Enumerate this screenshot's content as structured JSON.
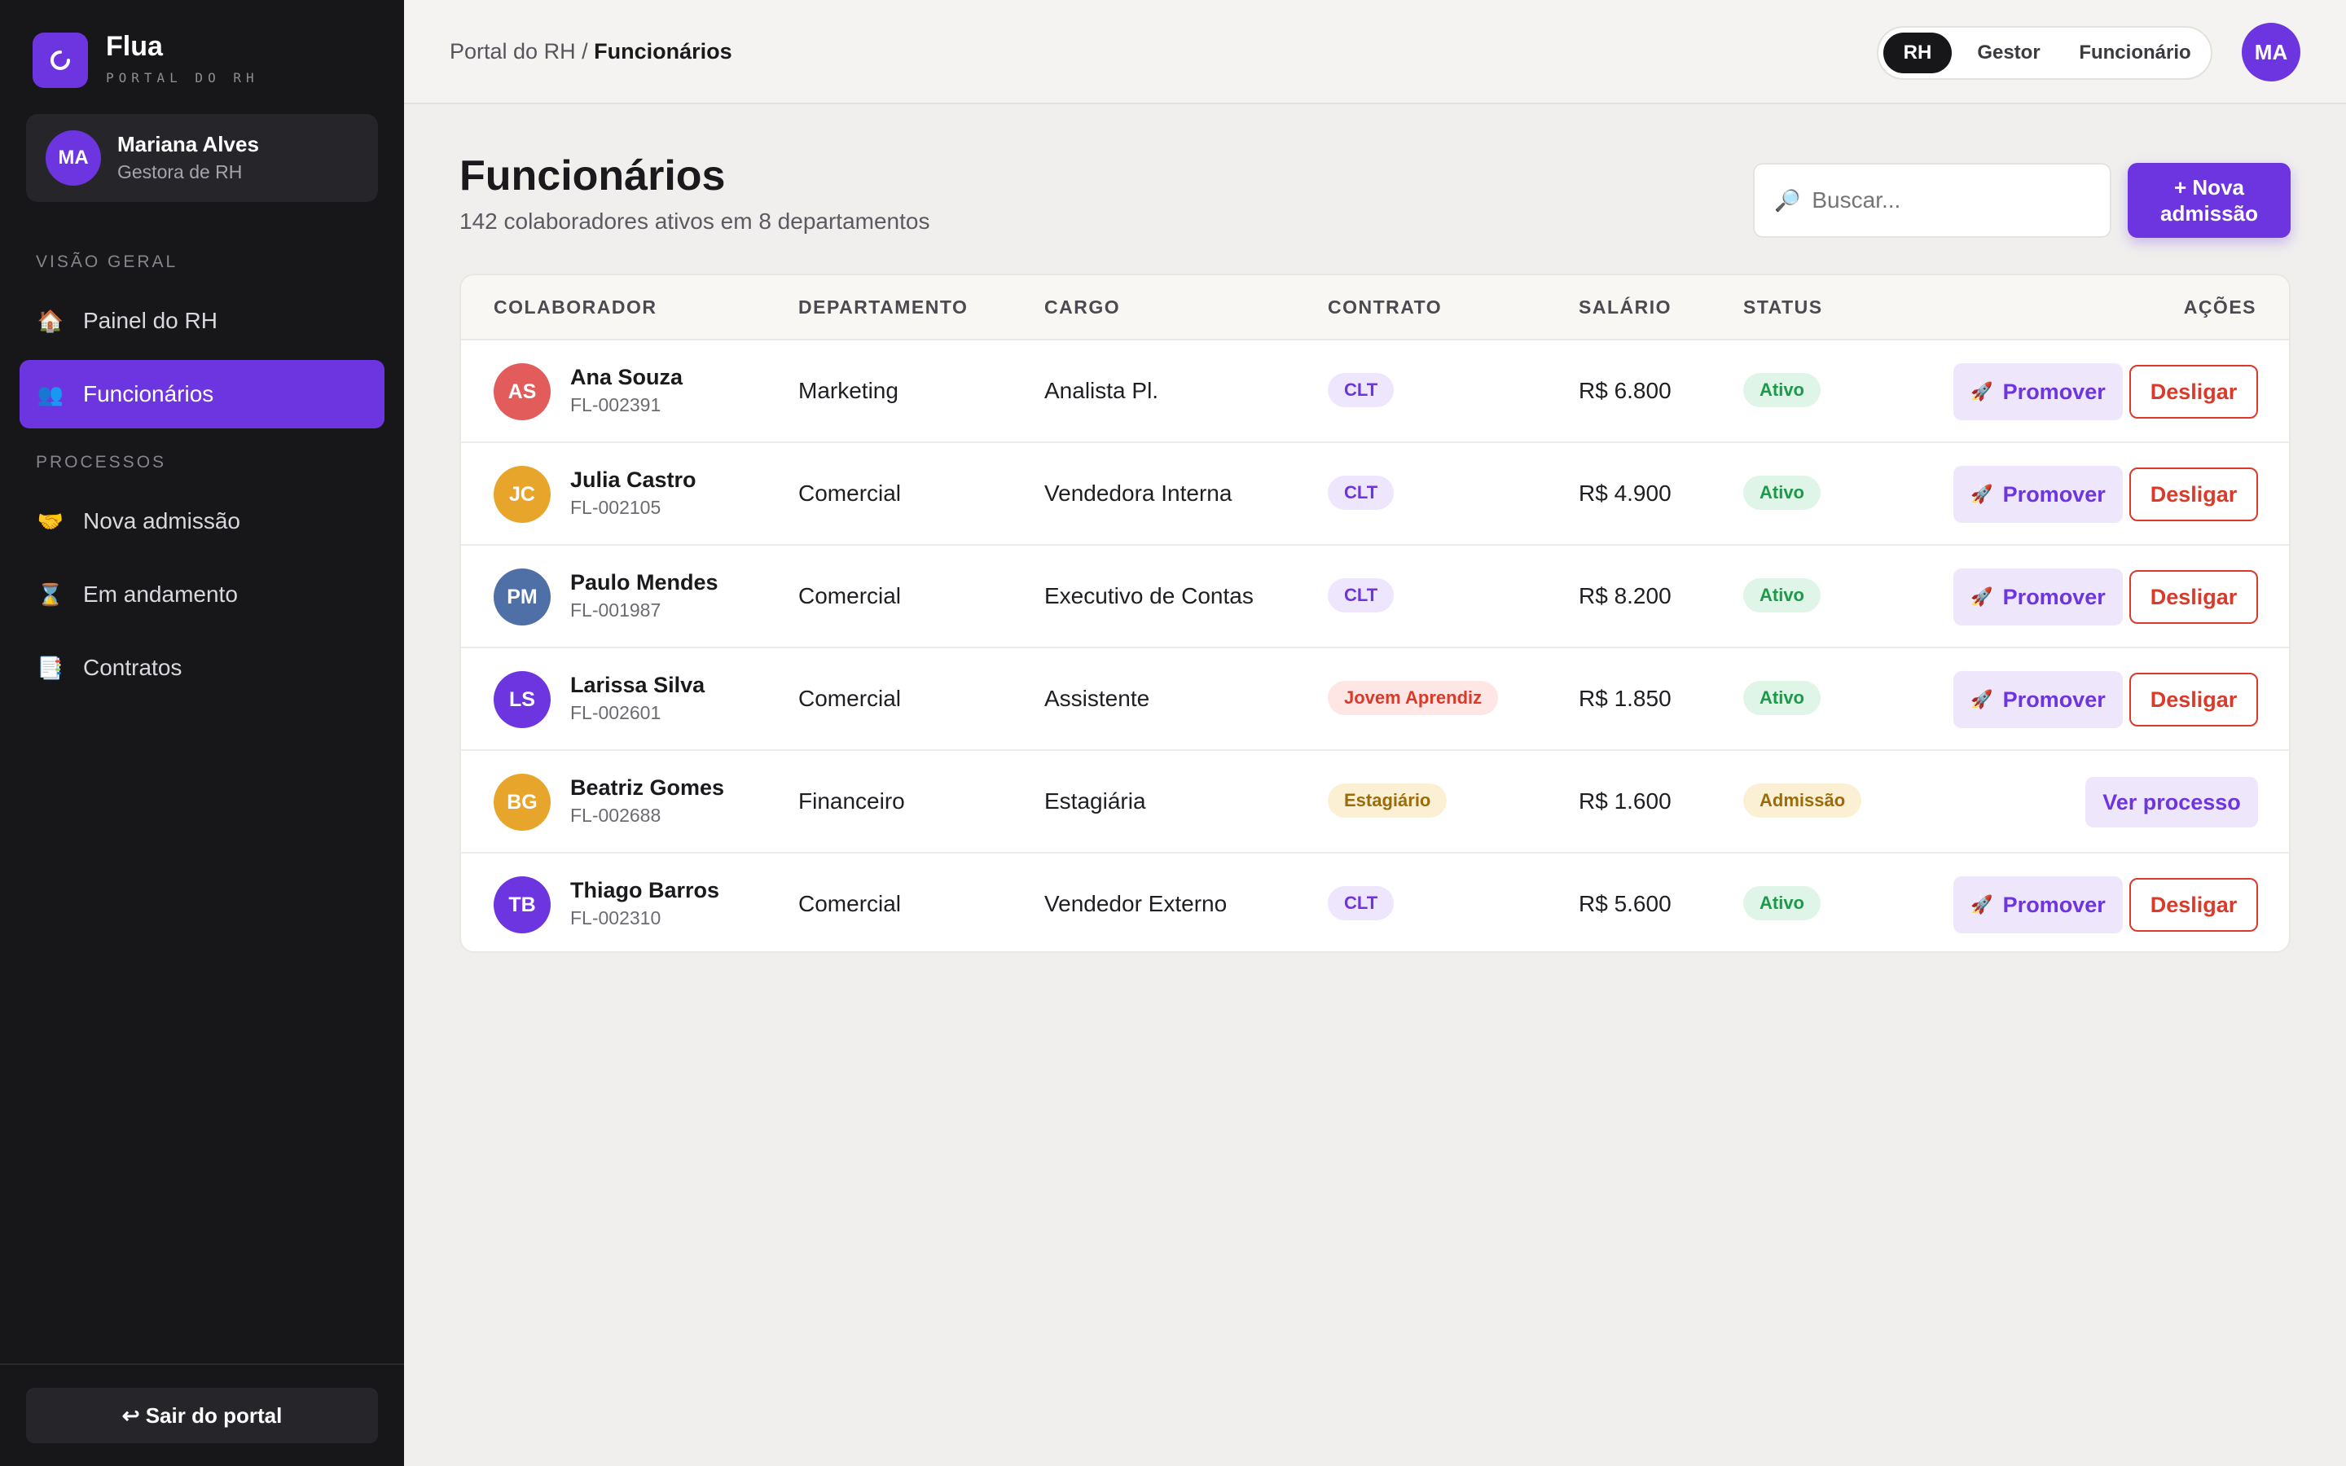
{
  "brand": {
    "name": "Flua",
    "subtitle": "PORTAL DO RH",
    "logo_icon": "refresh-icon"
  },
  "user": {
    "initials": "MA",
    "name": "Mariana Alves",
    "role": "Gestora de RH"
  },
  "sidebar": {
    "section_overview": "VISÃO GERAL",
    "section_processes": "PROCESSOS",
    "items": [
      {
        "label": "Painel do RH",
        "icon": "🏠"
      },
      {
        "label": "Funcionários",
        "icon": "👥",
        "active": true
      },
      {
        "label": "Nova admissão",
        "icon": "🤝"
      },
      {
        "label": "Em andamento",
        "icon": "⌛"
      },
      {
        "label": "Contratos",
        "icon": "📑"
      }
    ],
    "logout": "↩ Sair do portal"
  },
  "topbar": {
    "breadcrumb_root": "Portal do RH",
    "breadcrumb_sep": " / ",
    "breadcrumb_current": "Funcionários",
    "roles": [
      "RH",
      "Gestor",
      "Funcionário"
    ],
    "active_role": "RH",
    "avatar_initials": "MA"
  },
  "header": {
    "title": "Funcionários",
    "subtitle": "142 colaboradores ativos em 8 departamentos",
    "search_placeholder": "Buscar...",
    "new_button": "+ Nova admissão"
  },
  "table": {
    "columns": [
      "COLABORADOR",
      "DEPARTAMENTO",
      "CARGO",
      "CONTRATO",
      "SALÁRIO",
      "STATUS",
      "AÇÕES"
    ],
    "actions": {
      "promote": "Promover",
      "dismiss": "Desligar",
      "view_process": "Ver processo"
    },
    "rows": [
      {
        "initials": "AS",
        "name": "Ana Souza",
        "id": "FL-002391",
        "department": "Marketing",
        "role": "Analista Pl.",
        "contract": "CLT",
        "salary": "R$ 6.800",
        "status": "Ativo",
        "avatar_color": "#e25c5c"
      },
      {
        "initials": "JC",
        "name": "Julia Castro",
        "id": "FL-002105",
        "department": "Comercial",
        "role": "Vendedora Interna",
        "contract": "CLT",
        "salary": "R$ 4.900",
        "status": "Ativo",
        "avatar_color": "#e7a52c"
      },
      {
        "initials": "PM",
        "name": "Paulo Mendes",
        "id": "FL-001987",
        "department": "Comercial",
        "role": "Executivo de Contas",
        "contract": "CLT",
        "salary": "R$ 8.200",
        "status": "Ativo",
        "avatar_color": "#4f70a6"
      },
      {
        "initials": "LS",
        "name": "Larissa Silva",
        "id": "FL-002601",
        "department": "Comercial",
        "role": "Assistente",
        "contract": "Jovem Aprendiz",
        "salary": "R$ 1.850",
        "status": "Ativo",
        "avatar_color": "#6d35e0"
      },
      {
        "initials": "BG",
        "name": "Beatriz Gomes",
        "id": "FL-002688",
        "department": "Financeiro",
        "role": "Estagiária",
        "contract": "Estagiário",
        "salary": "R$ 1.600",
        "status": "Admissão",
        "avatar_color": "#e7a52c"
      },
      {
        "initials": "TB",
        "name": "Thiago Barros",
        "id": "FL-002310",
        "department": "Comercial",
        "role": "Vendedor Externo",
        "contract": "CLT",
        "salary": "R$ 5.600",
        "status": "Ativo",
        "avatar_color": "#6d35e0"
      }
    ]
  },
  "colors": {
    "accent": "#6d35e0",
    "sidebar_bg": "#17171a",
    "danger": "#d93a2a",
    "success": "#1c9a4a",
    "warning": "#9a6c0c"
  }
}
